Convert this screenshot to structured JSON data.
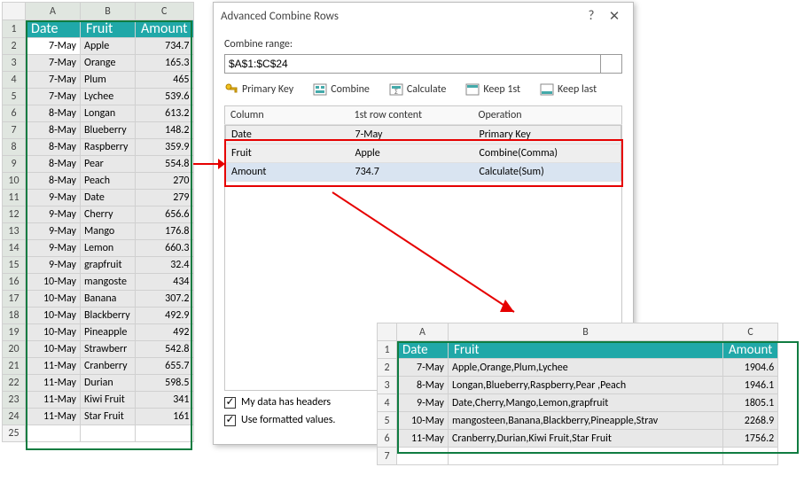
{
  "sheet1": {
    "cols": [
      "A",
      "B",
      "C"
    ],
    "header": {
      "date": "Date",
      "fruit": "Fruit",
      "amount": "Amount"
    },
    "rows": [
      {
        "n": 2,
        "date": "7-May",
        "fruit": "Apple",
        "amount": "734.7"
      },
      {
        "n": 3,
        "date": "7-May",
        "fruit": "Orange",
        "amount": "165.3"
      },
      {
        "n": 4,
        "date": "7-May",
        "fruit": "Plum",
        "amount": "465"
      },
      {
        "n": 5,
        "date": "7-May",
        "fruit": "Lychee",
        "amount": "539.6"
      },
      {
        "n": 6,
        "date": "8-May",
        "fruit": "Longan",
        "amount": "613.2"
      },
      {
        "n": 7,
        "date": "8-May",
        "fruit": "Blueberry",
        "amount": "148.2"
      },
      {
        "n": 8,
        "date": "8-May",
        "fruit": "Raspberry",
        "amount": "359.9"
      },
      {
        "n": 9,
        "date": "8-May",
        "fruit": "Pear",
        "amount": "554.8"
      },
      {
        "n": 10,
        "date": "8-May",
        "fruit": "Peach",
        "amount": "270"
      },
      {
        "n": 11,
        "date": "9-May",
        "fruit": "Date",
        "amount": "279"
      },
      {
        "n": 12,
        "date": "9-May",
        "fruit": "Cherry",
        "amount": "656.6"
      },
      {
        "n": 13,
        "date": "9-May",
        "fruit": "Mango",
        "amount": "176.8"
      },
      {
        "n": 14,
        "date": "9-May",
        "fruit": "Lemon",
        "amount": "660.3"
      },
      {
        "n": 15,
        "date": "9-May",
        "fruit": "grapfruit",
        "amount": "32.4"
      },
      {
        "n": 16,
        "date": "10-May",
        "fruit": "mangoste",
        "amount": "434"
      },
      {
        "n": 17,
        "date": "10-May",
        "fruit": "Banana",
        "amount": "307.2"
      },
      {
        "n": 18,
        "date": "10-May",
        "fruit": "Blackberry",
        "amount": "492.9"
      },
      {
        "n": 19,
        "date": "10-May",
        "fruit": "Pineapple",
        "amount": "492"
      },
      {
        "n": 20,
        "date": "10-May",
        "fruit": "Strawberr",
        "amount": "542.8"
      },
      {
        "n": 21,
        "date": "11-May",
        "fruit": "Cranberry",
        "amount": "655.7"
      },
      {
        "n": 22,
        "date": "11-May",
        "fruit": "Durian",
        "amount": "598.5"
      },
      {
        "n": 23,
        "date": "11-May",
        "fruit": "Kiwi Fruit",
        "amount": "341"
      },
      {
        "n": 24,
        "date": "11-May",
        "fruit": "Star Fruit",
        "amount": "161"
      }
    ],
    "last_row_label": "25"
  },
  "dialog": {
    "title": "Advanced Combine Rows",
    "combine_label": "Combine range:",
    "range": "$A$1:$C$24",
    "buttons": {
      "primary": "Primary Key",
      "combine": "Combine",
      "calc": "Calculate",
      "keep1": "Keep 1st",
      "keeplast": "Keep last"
    },
    "grid": {
      "h_col": "Column",
      "h_first": "1st row content",
      "h_op": "Operation",
      "rows": [
        {
          "col": "Date",
          "first": "7-May",
          "op": "Primary Key"
        },
        {
          "col": "Fruit",
          "first": "Apple",
          "op": "Combine(Comma)"
        },
        {
          "col": "Amount",
          "first": "734.7",
          "op": "Calculate(Sum)"
        }
      ]
    },
    "chk1": "My data has headers",
    "chk2": "Use formatted values."
  },
  "sheet2": {
    "cols": [
      "A",
      "B",
      "C"
    ],
    "header": {
      "date": "Date",
      "fruit": "Fruit",
      "amount": "Amount"
    },
    "rows": [
      {
        "n": 2,
        "date": "7-May",
        "fruit": "Apple,Orange,Plum,Lychee",
        "amount": "1904.6"
      },
      {
        "n": 3,
        "date": "8-May",
        "fruit": "Longan,Blueberry,Raspberry,Pear ,Peach",
        "amount": "1946.1"
      },
      {
        "n": 4,
        "date": "9-May",
        "fruit": "Date,Cherry,Mango,Lemon,grapfruit",
        "amount": "1805.1"
      },
      {
        "n": 5,
        "date": "10-May",
        "fruit": "mangosteen,Banana,Blackberry,Pineapple,Strav",
        "amount": "2268.9"
      },
      {
        "n": 6,
        "date": "11-May",
        "fruit": "Cranberry,Durian,Kiwi Fruit,Star Fruit",
        "amount": "1756.2"
      }
    ],
    "last_row_label": "7"
  }
}
